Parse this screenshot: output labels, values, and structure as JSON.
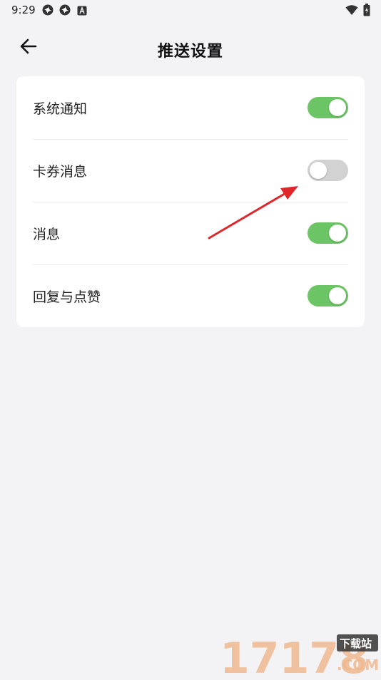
{
  "status_bar": {
    "time": "9:29",
    "icons": [
      "pinwheel-icon",
      "pinwheel-icon",
      "app-a-icon",
      "wifi-icon",
      "battery-icon"
    ]
  },
  "header": {
    "title": "推送设置",
    "back_icon": "arrow-left-icon"
  },
  "settings": [
    {
      "label": "系统通知",
      "enabled": true
    },
    {
      "label": "卡券消息",
      "enabled": false
    },
    {
      "label": "消息",
      "enabled": true
    },
    {
      "label": "回复与点赞",
      "enabled": true
    }
  ],
  "colors": {
    "toggle_on": "#6cc565",
    "toggle_off": "#d2d2d2",
    "annotation_arrow": "#e0262b",
    "background": "#f3f3f5"
  },
  "watermark": {
    "number": "17178",
    "tag": "下载站",
    "domain": ".COM"
  }
}
